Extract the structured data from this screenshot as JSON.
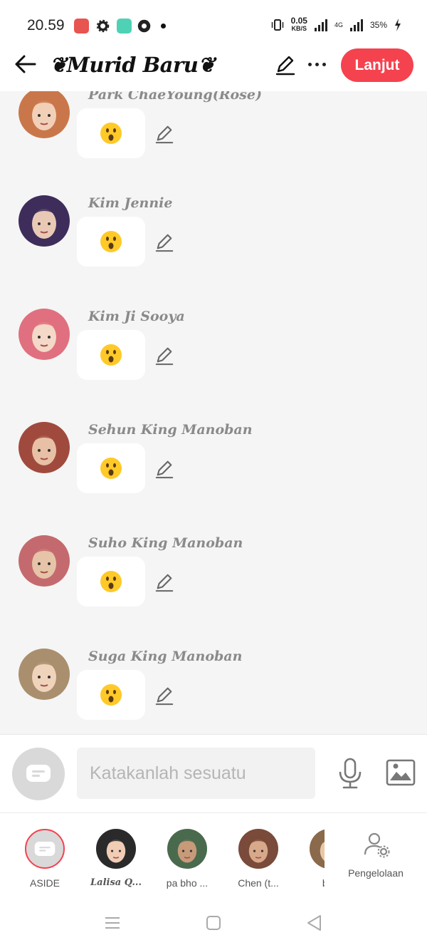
{
  "status_bar": {
    "time": "20.59",
    "speed_value": "0.05",
    "speed_unit": "KB/S",
    "network": "4G",
    "battery": "35%",
    "app_icon_colors": [
      "#e8544f",
      "#222222",
      "#4fd1b5",
      "#222222"
    ]
  },
  "header": {
    "title": "❦Murid Baru❦",
    "next_label": "Lanjut"
  },
  "messages": [
    {
      "name": "Park ChaeYoung(Rose)",
      "emoji": "astonished-face",
      "avatar_colors": [
        "#c9774a",
        "#f2d0b8"
      ]
    },
    {
      "name": "Kim Jennie",
      "emoji": "astonished-face",
      "avatar_colors": [
        "#3e2d5a",
        "#e9c9b5"
      ]
    },
    {
      "name": "Kim Ji Sooya",
      "emoji": "astonished-face",
      "avatar_colors": [
        "#e0707f",
        "#f4d8c8"
      ]
    },
    {
      "name": "Sehun King Manoban",
      "emoji": "astonished-face",
      "avatar_colors": [
        "#a04a3e",
        "#e8c0a5"
      ]
    },
    {
      "name": "Suho King Manoban",
      "emoji": "astonished-face",
      "avatar_colors": [
        "#c46a6e",
        "#e6c4a8"
      ]
    },
    {
      "name": "Suga King Manoban",
      "emoji": "astonished-face",
      "avatar_colors": [
        "#a98f6e",
        "#f0d3bb"
      ]
    }
  ],
  "input": {
    "placeholder": "Katakanlah sesuatu"
  },
  "roles": [
    {
      "label": "ASIDE",
      "selected": true
    },
    {
      "label": "Lalisa Q...",
      "avatar_colors": [
        "#2a2a2a",
        "#f1cdb6"
      ]
    },
    {
      "label": "pa bho ...",
      "avatar_colors": [
        "#4a6a4e",
        "#c79a7a"
      ]
    },
    {
      "label": "Chen (t...",
      "avatar_colors": [
        "#7a4a3a",
        "#d8a88a"
      ]
    },
    {
      "label": "bar",
      "avatar_colors": [
        "#8a6a4a",
        "#e8c8a8"
      ]
    }
  ],
  "manage": {
    "label": "Pengelolaan"
  },
  "colors": {
    "accent": "#f5424f",
    "name_gray": "#8a8a8a",
    "background": "#f5f5f5"
  }
}
